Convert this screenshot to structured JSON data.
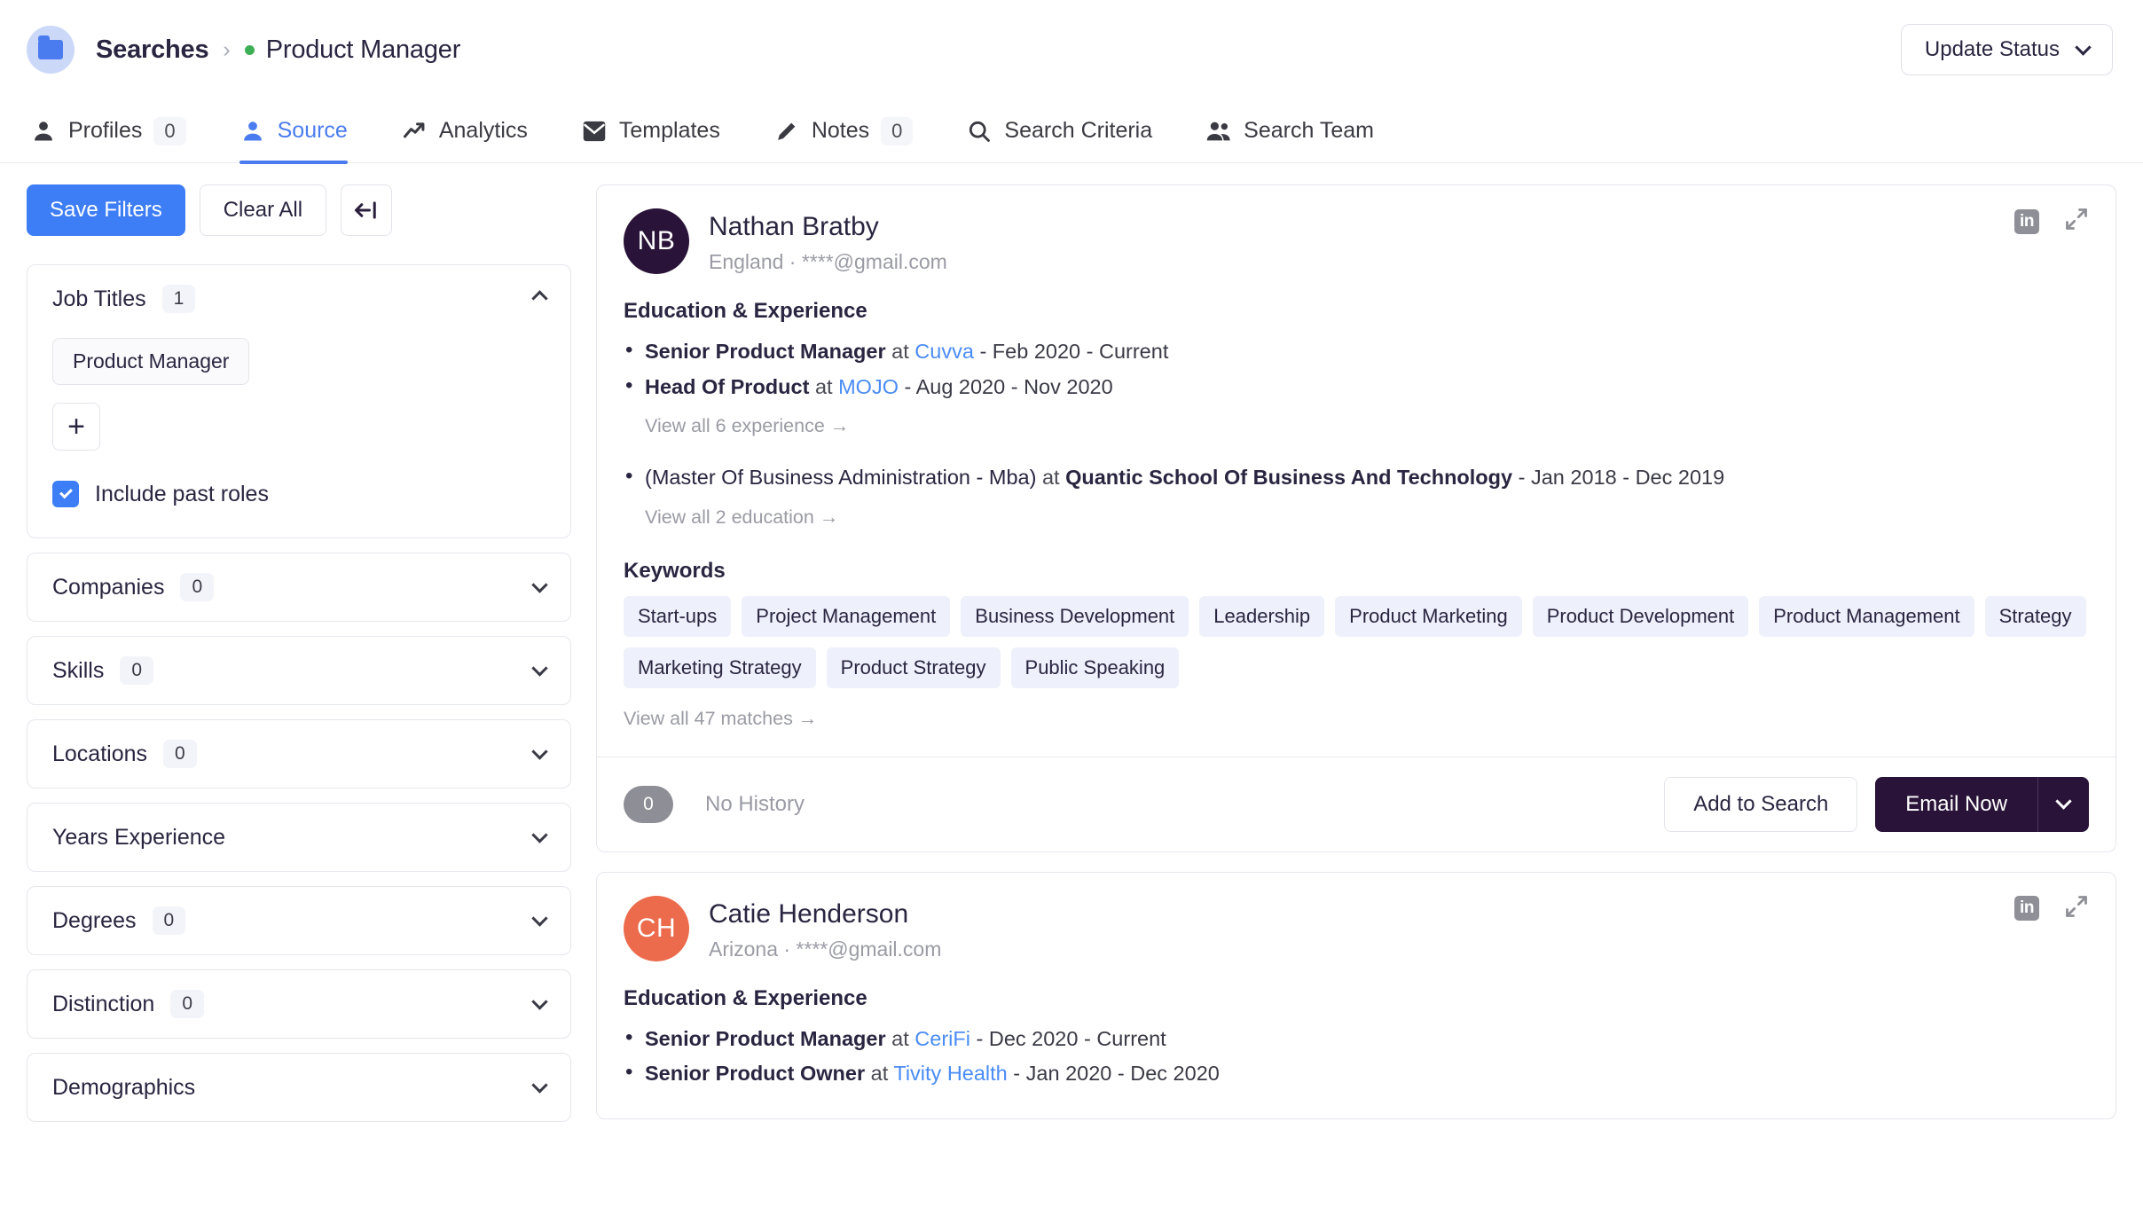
{
  "header": {
    "folder_icon": "folder-icon",
    "breadcrumb_root": "Searches",
    "breadcrumb_separator": "›",
    "breadcrumb_current": "Product Manager",
    "status_dot_color": "#3faf55",
    "update_status_label": "Update Status"
  },
  "tabs": [
    {
      "label": "Profiles",
      "count": "0",
      "icon": "person-icon",
      "active": false
    },
    {
      "label": "Source",
      "count": null,
      "icon": "person-icon",
      "active": true
    },
    {
      "label": "Analytics",
      "count": null,
      "icon": "trending-up-icon",
      "active": false
    },
    {
      "label": "Templates",
      "count": null,
      "icon": "envelope-icon",
      "active": false
    },
    {
      "label": "Notes",
      "count": "0",
      "icon": "pencil-icon",
      "active": false
    },
    {
      "label": "Search Criteria",
      "count": null,
      "icon": "magnifier-icon",
      "active": false
    },
    {
      "label": "Search Team",
      "count": null,
      "icon": "people-icon",
      "active": false
    }
  ],
  "sidebar": {
    "save_filters_label": "Save Filters",
    "clear_all_label": "Clear All",
    "collapse_icon": "collapse-panel-icon",
    "job_titles": {
      "title": "Job Titles",
      "count": "1",
      "expanded": true,
      "chips": [
        "Product Manager"
      ],
      "add_label": "+",
      "include_past_roles_label": "Include past roles",
      "include_past_roles_checked": true
    },
    "sections": [
      {
        "title": "Companies",
        "count": "0"
      },
      {
        "title": "Skills",
        "count": "0"
      },
      {
        "title": "Locations",
        "count": "0"
      },
      {
        "title": "Years Experience",
        "count": null
      },
      {
        "title": "Degrees",
        "count": "0"
      },
      {
        "title": "Distinction",
        "count": "0"
      },
      {
        "title": "Demographics",
        "count": null
      }
    ]
  },
  "results": {
    "section_labels": {
      "education_experience": "Education & Experience",
      "keywords": "Keywords",
      "at": "at"
    },
    "profiles": [
      {
        "initials": "NB",
        "avatar_color": "#2a1338",
        "name": "Nathan Bratby",
        "subtitle": "England · ****@gmail.com",
        "experience": [
          {
            "role": "Senior Product Manager",
            "company": "Cuvva",
            "dates": "Feb 2020 - Current"
          },
          {
            "role": "Head Of Product",
            "company": "MOJO",
            "dates": "Aug 2020 - Nov 2020"
          }
        ],
        "experience_viewall": "View all 6 experience →",
        "education": [
          {
            "degree": "(Master Of Business Administration - Mba)",
            "school": "Quantic School Of Business And Technology",
            "dates": "Jan 2018 - Dec 2019"
          }
        ],
        "education_viewall": "View all 2 education →",
        "keywords": [
          "Start-ups",
          "Project Management",
          "Business Development",
          "Leadership",
          "Product Marketing",
          "Product Development",
          "Product Management",
          "Strategy",
          "Marketing Strategy",
          "Product Strategy",
          "Public Speaking"
        ],
        "keywords_viewall": "View all 47 matches →",
        "footer": {
          "history_count": "0",
          "history_label": "No History",
          "add_to_search_label": "Add to Search",
          "email_now_label": "Email Now"
        }
      },
      {
        "initials": "CH",
        "avatar_color": "#ec6b4c",
        "name": "Catie Henderson",
        "subtitle": "Arizona · ****@gmail.com",
        "experience": [
          {
            "role": "Senior Product Manager",
            "company": "CeriFi",
            "dates": "Dec 2020 - Current"
          },
          {
            "role": "Senior Product Owner",
            "company": "Tivity Health",
            "dates": "Jan 2020 - Dec 2020"
          }
        ]
      }
    ]
  },
  "colors": {
    "accent_blue": "#3d7df5",
    "link_blue": "#4a8cf5",
    "dark_purple": "#2a1338",
    "orange": "#ec6b4c",
    "chip_bg": "#eef0fb",
    "green_dot": "#3faf55"
  }
}
